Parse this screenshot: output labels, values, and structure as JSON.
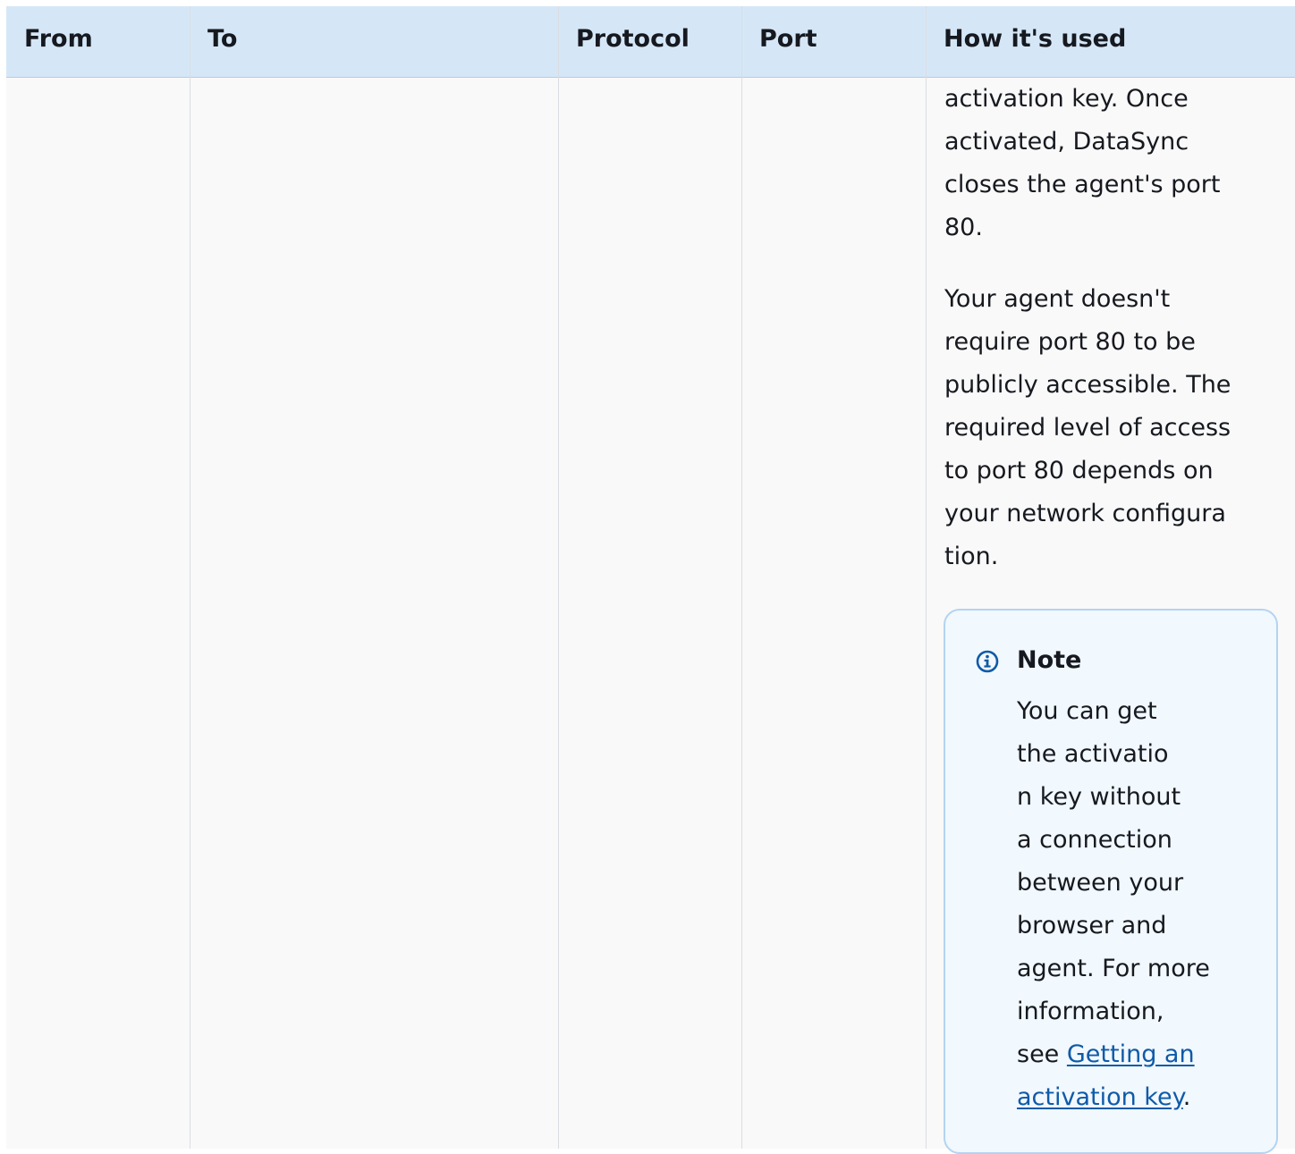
{
  "table": {
    "headers": [
      "From",
      "To",
      "Protocol",
      "Port",
      "How it's used"
    ],
    "row": {
      "how_it_is_used": {
        "paragraph_1": "activation key. Once\nactivated, DataSync\ncloses the agent's port\n80.",
        "paragraph_2": "Your agent doesn't\nrequire port 80 to be\npublicly accessible. The\nrequired level of access\nto port 80 depends on\nyour network configura\ntion."
      }
    }
  },
  "note": {
    "icon": "info-icon",
    "title": "Note",
    "body": "You can get\nthe activatio\nn key without\na connection\nbetween your\nbrowser and\nagent. For more\ninformation,\nsee ",
    "link_text": "Getting an\nactivation key",
    "after_link": ".",
    "accent_color": "#0f5aa8",
    "background_color": "#f1f8fe",
    "border_color": "#b3d4f0"
  },
  "colors": {
    "header_background": "#d5e7f7",
    "cell_background": "#f9f9f9",
    "text": "#16191f"
  }
}
